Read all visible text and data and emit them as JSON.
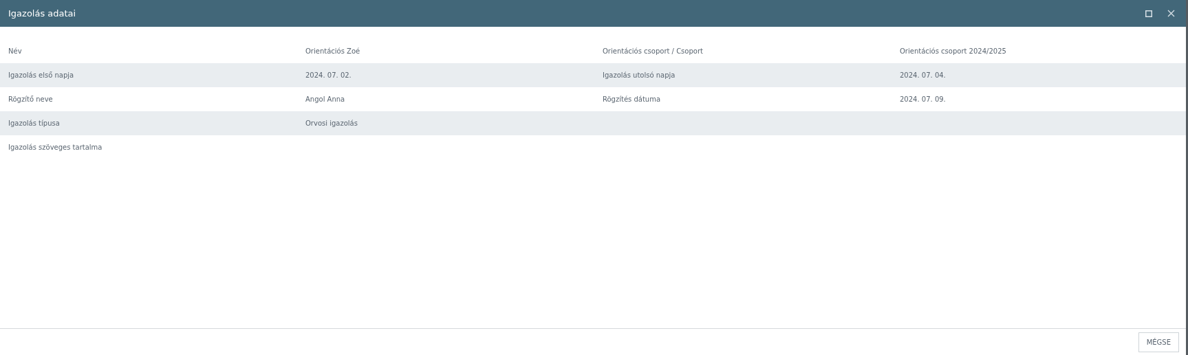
{
  "window": {
    "title": "Igazolás adatai"
  },
  "rows": [
    {
      "cells": [
        "Név",
        "Orientációs Zoé",
        "Orientációs csoport / Csoport",
        "Orientációs csoport 2024/2025"
      ]
    },
    {
      "cells": [
        "Igazolás első napja",
        "2024. 07. 02.",
        "Igazolás utolsó napja",
        "2024. 07. 04."
      ]
    },
    {
      "cells": [
        "Rögzítő neve",
        "Angol Anna",
        "Rögzítés dátuma",
        "2024. 07. 09."
      ]
    },
    {
      "cells": [
        "Igazolás típusa",
        "Orvosi igazolás"
      ]
    },
    {
      "cells": [
        "Igazolás szöveges tartalma"
      ]
    }
  ],
  "buttons": [
    "MÉGSE"
  ]
}
